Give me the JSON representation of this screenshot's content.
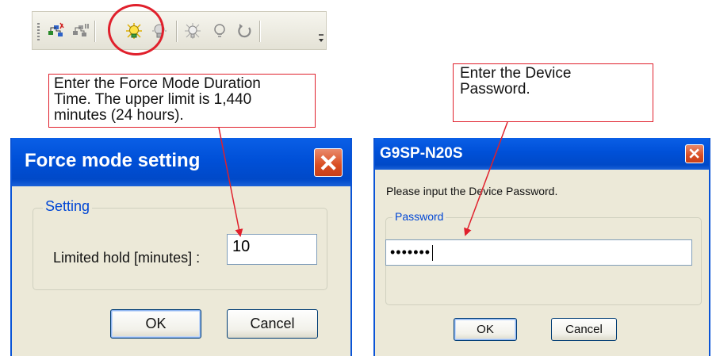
{
  "toolbar": {
    "buttons": [
      {
        "icon": "network-online-icon"
      },
      {
        "icon": "network-offline-icon"
      },
      {
        "icon": "force-mode-icon",
        "highlighted": true
      },
      {
        "icon": "force-release-icon"
      },
      {
        "icon": "bulb-on-icon"
      },
      {
        "icon": "bulb-off-icon"
      },
      {
        "icon": "refresh-icon"
      }
    ]
  },
  "callouts": {
    "force_duration": "Enter the Force Mode Duration\nTime. The upper limit is 1,440\nminutes (24 hours).",
    "device_password": "Enter the Device\nPassword."
  },
  "force_dialog": {
    "title": "Force mode setting",
    "group_label": "Setting",
    "field_label": "Limited hold [minutes] :",
    "field_value": "10",
    "ok_label": "OK",
    "cancel_label": "Cancel"
  },
  "password_dialog": {
    "title": "G9SP-N20S",
    "prompt": "Please input the Device Password.",
    "group_label": "Password",
    "password_mask": "•••••••",
    "ok_label": "OK",
    "cancel_label": "Cancel"
  },
  "colors": {
    "highlight": "#e0202c",
    "titlebar": "#0050d8",
    "dialog_bg": "#ece9d8"
  }
}
